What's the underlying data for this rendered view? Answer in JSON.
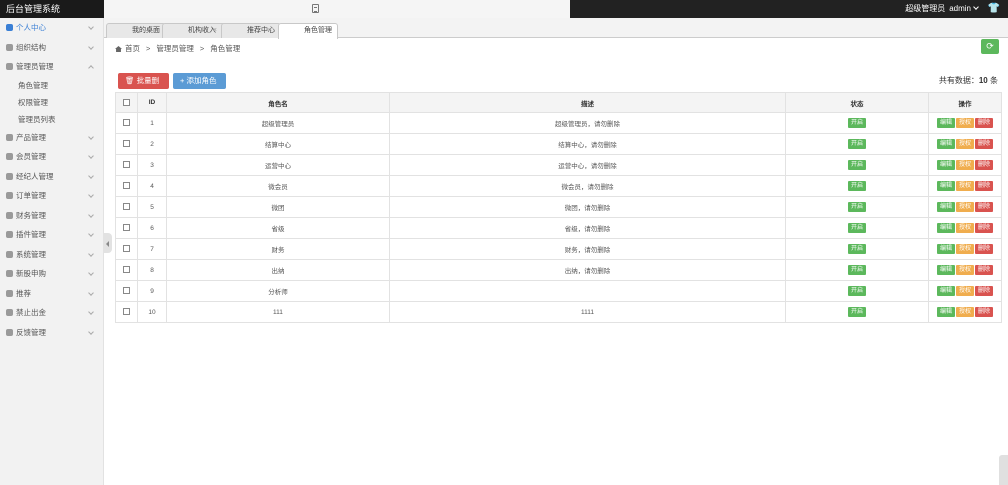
{
  "app": {
    "title": "后台管理系统"
  },
  "topbar": {
    "user_role": "超级管理员",
    "user_name": "admin"
  },
  "sidebar": {
    "items": [
      {
        "label": "个人中心",
        "active": true
      },
      {
        "label": "组织结构"
      },
      {
        "label": "管理员管理",
        "expanded": true
      },
      {
        "label": "产品管理"
      },
      {
        "label": "会员管理"
      },
      {
        "label": "经纪人管理"
      },
      {
        "label": "订单管理"
      },
      {
        "label": "财务管理"
      },
      {
        "label": "插件管理"
      },
      {
        "label": "系统管理"
      },
      {
        "label": "新股申购"
      },
      {
        "label": "推荐"
      },
      {
        "label": "禁止出金"
      },
      {
        "label": "反馈管理"
      }
    ],
    "sub_items": [
      "角色管理",
      "权限管理",
      "管理员列表"
    ]
  },
  "tabs": [
    {
      "label": "我的桌面"
    },
    {
      "label": "机构收入"
    },
    {
      "label": "推荐中心"
    },
    {
      "label": "角色管理"
    }
  ],
  "breadcrumb": {
    "home": "首页",
    "level1": "管理员管理",
    "level2": "角色管理"
  },
  "toolbar": {
    "batch_delete": "批量删除",
    "add_role": "添加角色",
    "total_prefix": "共有数据：",
    "total_count": "10",
    "total_suffix": " 条"
  },
  "table": {
    "headers": {
      "id": "ID",
      "name": "角色名",
      "desc": "描述",
      "status": "状态",
      "action": "操作"
    },
    "status_label": "开启",
    "action_labels": {
      "edit": "编辑",
      "grant": "授权",
      "delete": "删除"
    },
    "rows": [
      {
        "id": "1",
        "name": "超级管理员",
        "desc": "超级管理员，请勿删除"
      },
      {
        "id": "2",
        "name": "结算中心",
        "desc": "结算中心，请勿删除"
      },
      {
        "id": "3",
        "name": "运营中心",
        "desc": "运营中心，请勿删除"
      },
      {
        "id": "4",
        "name": "微会员",
        "desc": "微会员，请勿删除"
      },
      {
        "id": "5",
        "name": "微团",
        "desc": "微团，请勿删除"
      },
      {
        "id": "6",
        "name": "省级",
        "desc": "省级，请勿删除"
      },
      {
        "id": "7",
        "name": "财务",
        "desc": "财务，请勿删除"
      },
      {
        "id": "8",
        "name": "出纳",
        "desc": "出纳，请勿删除"
      },
      {
        "id": "9",
        "name": "分析师",
        "desc": ""
      },
      {
        "id": "10",
        "name": "111",
        "desc": "1111"
      }
    ]
  },
  "colors": {
    "topbar": "#222222",
    "active_nav": "#3a7fd5",
    "green": "#5cb85c",
    "orange": "#f0ad4e",
    "red": "#d9534f",
    "blue": "#5b9bd5"
  }
}
